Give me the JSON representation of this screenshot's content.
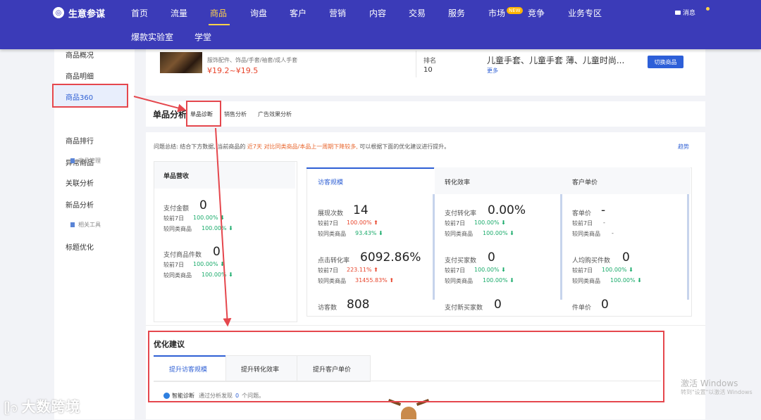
{
  "nav": {
    "logo": "生意参谋",
    "items": [
      "首页",
      "流量",
      "商品",
      "询盘",
      "客户",
      "营销",
      "内容",
      "交易",
      "服务",
      "市场",
      "竞争",
      "业务专区"
    ],
    "active": "商品",
    "new_badge": "NEW",
    "message": "消息",
    "sub_items": [
      "爆款实验室",
      "学堂"
    ]
  },
  "sidebar": {
    "items": [
      "商品概况",
      "商品明细",
      "商品360",
      "商品排行",
      "异常商品",
      "关联分析",
      "新品分析",
      "标题优化"
    ],
    "sub_items": [
      "商品管理",
      "相关工具"
    ]
  },
  "product": {
    "category": "服饰配件、饰品/手套/袖套/成人手套",
    "price": "¥19.2~¥19.5",
    "rank_label": "排名",
    "rank_value": "10",
    "keywords": "儿童手套、儿童手套 薄、儿童时尚...",
    "more": "更多",
    "switch_button": "切换商品"
  },
  "analysis": {
    "title": "单品分析",
    "tabs": [
      "单品诊断",
      "销售分析",
      "广告效果分析"
    ],
    "summary_prefix": "问题总结: 结合下方数据, 当前商品的",
    "summary_highlight": "近7天 对比同类商品/本品上一周期下降较多,",
    "summary_suffix": "可以根据下面的优化建议进行提升。",
    "trend": "趋势"
  },
  "revenue": {
    "title": "单品营收",
    "pay_amount_label": "支付金额",
    "pay_amount_value": "0",
    "pay_count_label": "支付商品件数",
    "pay_count_value": "0",
    "vs7": "较前7日",
    "vs_same": "较同类商品",
    "pct": "100.00%"
  },
  "visitors": {
    "title": "访客规模",
    "m1_label": "展现次数",
    "m1_value": "14",
    "m1_vs7": "100.00%",
    "m1_same": "93.43%",
    "m2_label": "点击转化率",
    "m2_value": "6092.86%",
    "m2_vs7": "223.11%",
    "m2_same": "31455.83%",
    "m3_label": "访客数",
    "m3_value": "808"
  },
  "conversion": {
    "title": "转化效率",
    "m1_label": "支付转化率",
    "m1_value": "0.00%",
    "m2_label": "支付买家数",
    "m2_value": "0",
    "m3_label": "支付新买家数",
    "m3_value": "0",
    "pct": "100.00%"
  },
  "unit_price": {
    "title": "客户单价",
    "m1_label": "客单价",
    "m1_value": "-",
    "dash": "-",
    "m2_label": "人均购买件数",
    "m2_value": "0",
    "m3_label": "件单价",
    "m3_value": "0",
    "pct": "100.00%"
  },
  "labels": {
    "vs7": "较前7日",
    "vs_same": "较同类商品"
  },
  "optimize": {
    "title": "优化建议",
    "tabs": [
      "提升访客规模",
      "提升转化效率",
      "提升客户单价"
    ],
    "smart": "智能诊断",
    "found_prefix": "通过分析发现",
    "found_count": "0",
    "found_suffix": "个问题。"
  },
  "watermark": {
    "line1": "激活 Windows",
    "line2": "转到\"设置\"以激活 Windows"
  },
  "brand": "大数跨境"
}
